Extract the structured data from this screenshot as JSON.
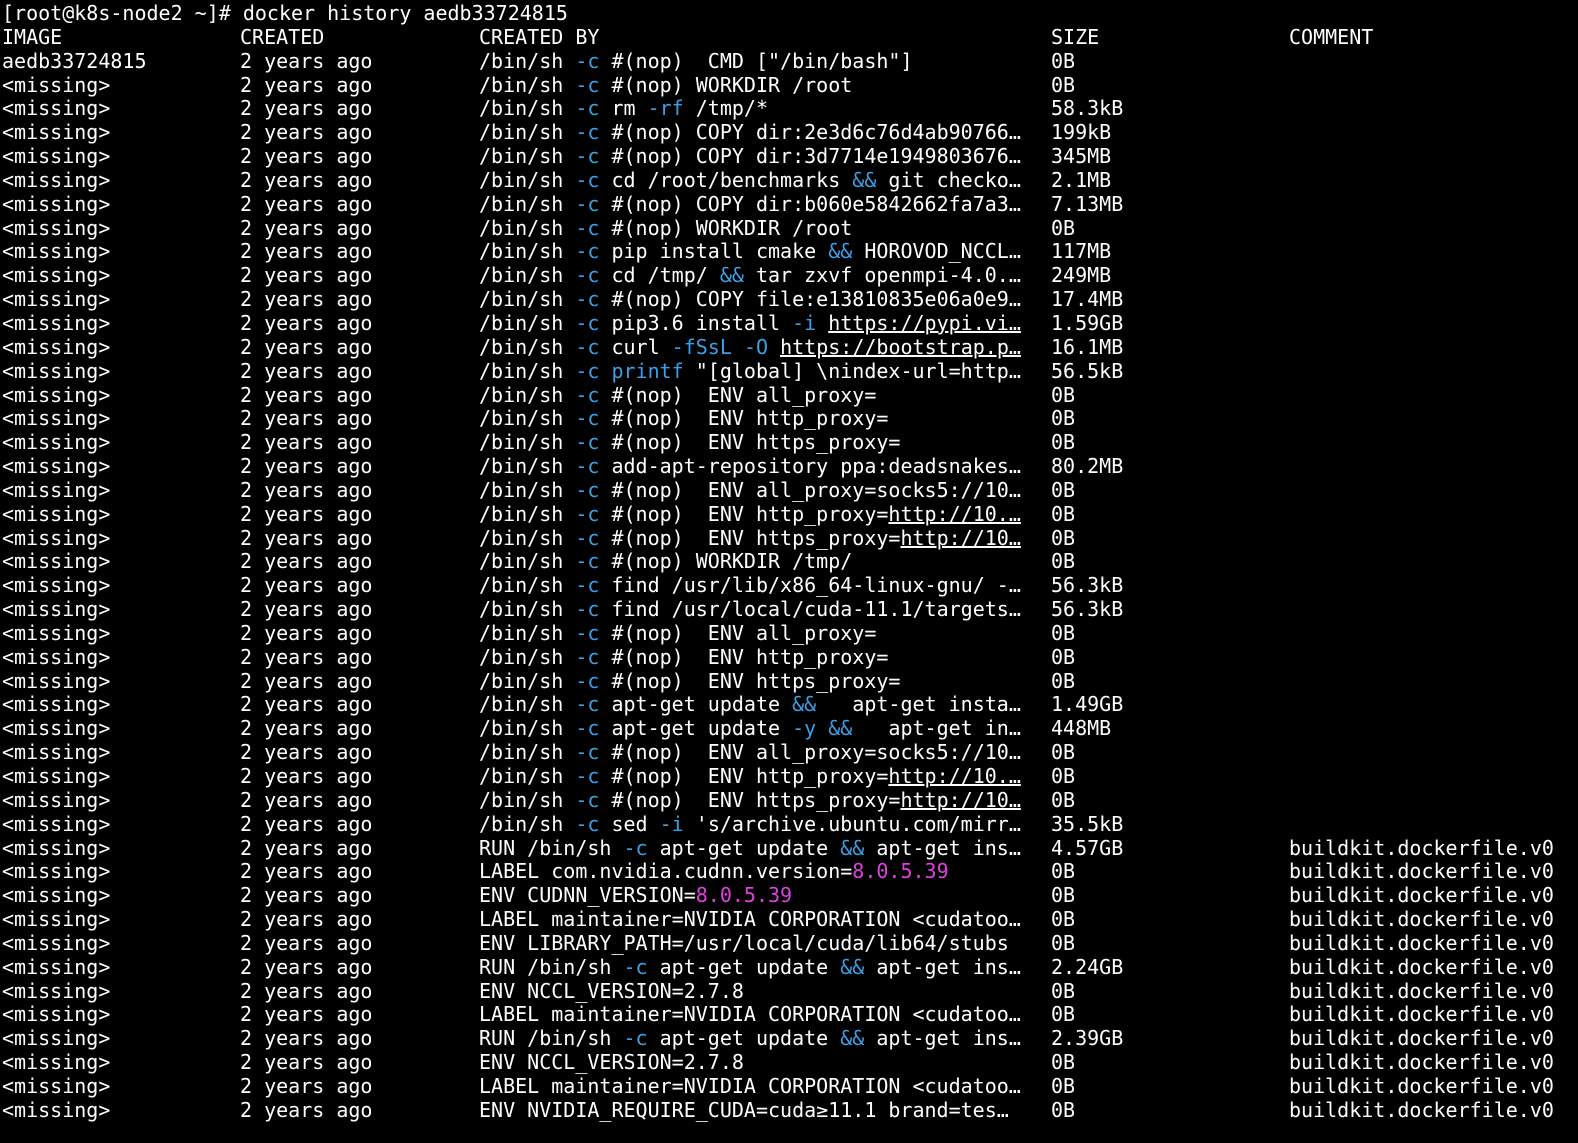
{
  "prompt": "[root@k8s-node2 ~]# docker history aedb33724815",
  "headers": {
    "image": "IMAGE",
    "created": "CREATED",
    "created_by": "CREATED BY",
    "size": "SIZE",
    "comment": "COMMENT"
  },
  "colors": {
    "background": "#000000",
    "text": "#ffffff",
    "flag_blue": "#3aa0e8",
    "version_magenta": "#e040e0"
  },
  "rows": [
    {
      "image": "aedb33724815",
      "created": "2 years ago",
      "by": [
        [
          "/bin/sh ",
          ""
        ],
        [
          "-c",
          "f"
        ],
        [
          " #(nop)  CMD [\"/bin/bash\"]",
          ""
        ]
      ],
      "size": "0B",
      "comment": ""
    },
    {
      "image": "<missing>",
      "created": "2 years ago",
      "by": [
        [
          "/bin/sh ",
          ""
        ],
        [
          "-c",
          "f"
        ],
        [
          " #(nop) WORKDIR /root",
          ""
        ]
      ],
      "size": "0B",
      "comment": ""
    },
    {
      "image": "<missing>",
      "created": "2 years ago",
      "by": [
        [
          "/bin/sh ",
          ""
        ],
        [
          "-c",
          "f"
        ],
        [
          " rm ",
          ""
        ],
        [
          "-rf",
          "f"
        ],
        [
          " /tmp/*",
          ""
        ]
      ],
      "size": "58.3kB",
      "comment": ""
    },
    {
      "image": "<missing>",
      "created": "2 years ago",
      "by": [
        [
          "/bin/sh ",
          ""
        ],
        [
          "-c",
          "f"
        ],
        [
          " #(nop) COPY dir:2e3d6c76d4ab90766…",
          ""
        ]
      ],
      "size": "199kB",
      "comment": ""
    },
    {
      "image": "<missing>",
      "created": "2 years ago",
      "by": [
        [
          "/bin/sh ",
          ""
        ],
        [
          "-c",
          "f"
        ],
        [
          " #(nop) COPY dir:3d7714e1949803676…",
          ""
        ]
      ],
      "size": "345MB",
      "comment": ""
    },
    {
      "image": "<missing>",
      "created": "2 years ago",
      "by": [
        [
          "/bin/sh ",
          ""
        ],
        [
          "-c",
          "f"
        ],
        [
          " cd /root/benchmarks ",
          ""
        ],
        [
          "&&",
          "f"
        ],
        [
          " git checko…",
          ""
        ]
      ],
      "size": "2.1MB",
      "comment": ""
    },
    {
      "image": "<missing>",
      "created": "2 years ago",
      "by": [
        [
          "/bin/sh ",
          ""
        ],
        [
          "-c",
          "f"
        ],
        [
          " #(nop) COPY dir:b060e5842662fa7a3…",
          ""
        ]
      ],
      "size": "7.13MB",
      "comment": ""
    },
    {
      "image": "<missing>",
      "created": "2 years ago",
      "by": [
        [
          "/bin/sh ",
          ""
        ],
        [
          "-c",
          "f"
        ],
        [
          " #(nop) WORKDIR /root",
          ""
        ]
      ],
      "size": "0B",
      "comment": ""
    },
    {
      "image": "<missing>",
      "created": "2 years ago",
      "by": [
        [
          "/bin/sh ",
          ""
        ],
        [
          "-c",
          "f"
        ],
        [
          " pip install cmake ",
          ""
        ],
        [
          "&&",
          "f"
        ],
        [
          " HOROVOD_NCCL…",
          ""
        ]
      ],
      "size": "117MB",
      "comment": ""
    },
    {
      "image": "<missing>",
      "created": "2 years ago",
      "by": [
        [
          "/bin/sh ",
          ""
        ],
        [
          "-c",
          "f"
        ],
        [
          " cd /tmp/ ",
          ""
        ],
        [
          "&&",
          "f"
        ],
        [
          " tar zxvf openmpi-4.0.…",
          ""
        ]
      ],
      "size": "249MB",
      "comment": ""
    },
    {
      "image": "<missing>",
      "created": "2 years ago",
      "by": [
        [
          "/bin/sh ",
          ""
        ],
        [
          "-c",
          "f"
        ],
        [
          " #(nop) COPY file:e13810835e06a0e9…",
          ""
        ]
      ],
      "size": "17.4MB",
      "comment": ""
    },
    {
      "image": "<missing>",
      "created": "2 years ago",
      "by": [
        [
          "/bin/sh ",
          ""
        ],
        [
          "-c",
          "f"
        ],
        [
          " pip3.6 install ",
          ""
        ],
        [
          "-i",
          "f"
        ],
        [
          " ",
          ""
        ],
        [
          "https://pypi.vi…",
          "u"
        ]
      ],
      "size": "1.59GB",
      "comment": ""
    },
    {
      "image": "<missing>",
      "created": "2 years ago",
      "by": [
        [
          "/bin/sh ",
          ""
        ],
        [
          "-c",
          "f"
        ],
        [
          " curl ",
          ""
        ],
        [
          "-fSsL",
          "f"
        ],
        [
          " ",
          ""
        ],
        [
          "-O",
          "f"
        ],
        [
          " ",
          ""
        ],
        [
          "https://bootstrap.p…",
          "u"
        ]
      ],
      "size": "16.1MB",
      "comment": ""
    },
    {
      "image": "<missing>",
      "created": "2 years ago",
      "by": [
        [
          "/bin/sh ",
          ""
        ],
        [
          "-c",
          "f"
        ],
        [
          " ",
          ""
        ],
        [
          "printf",
          "f"
        ],
        [
          " \"[global] \\nindex-url=http…",
          ""
        ]
      ],
      "size": "56.5kB",
      "comment": ""
    },
    {
      "image": "<missing>",
      "created": "2 years ago",
      "by": [
        [
          "/bin/sh ",
          ""
        ],
        [
          "-c",
          "f"
        ],
        [
          " #(nop)  ENV all_proxy=",
          ""
        ]
      ],
      "size": "0B",
      "comment": ""
    },
    {
      "image": "<missing>",
      "created": "2 years ago",
      "by": [
        [
          "/bin/sh ",
          ""
        ],
        [
          "-c",
          "f"
        ],
        [
          " #(nop)  ENV http_proxy=",
          ""
        ]
      ],
      "size": "0B",
      "comment": ""
    },
    {
      "image": "<missing>",
      "created": "2 years ago",
      "by": [
        [
          "/bin/sh ",
          ""
        ],
        [
          "-c",
          "f"
        ],
        [
          " #(nop)  ENV https_proxy=",
          ""
        ]
      ],
      "size": "0B",
      "comment": ""
    },
    {
      "image": "<missing>",
      "created": "2 years ago",
      "by": [
        [
          "/bin/sh ",
          ""
        ],
        [
          "-c",
          "f"
        ],
        [
          " add-apt-repository ppa:deadsnakes…",
          ""
        ]
      ],
      "size": "80.2MB",
      "comment": ""
    },
    {
      "image": "<missing>",
      "created": "2 years ago",
      "by": [
        [
          "/bin/sh ",
          ""
        ],
        [
          "-c",
          "f"
        ],
        [
          " #(nop)  ENV all_proxy=socks5://10…",
          ""
        ]
      ],
      "size": "0B",
      "comment": ""
    },
    {
      "image": "<missing>",
      "created": "2 years ago",
      "by": [
        [
          "/bin/sh ",
          ""
        ],
        [
          "-c",
          "f"
        ],
        [
          " #(nop)  ENV http_proxy=",
          ""
        ],
        [
          "http://10.…",
          "u"
        ]
      ],
      "size": "0B",
      "comment": ""
    },
    {
      "image": "<missing>",
      "created": "2 years ago",
      "by": [
        [
          "/bin/sh ",
          ""
        ],
        [
          "-c",
          "f"
        ],
        [
          " #(nop)  ENV https_proxy=",
          ""
        ],
        [
          "http://10…",
          "u"
        ]
      ],
      "size": "0B",
      "comment": ""
    },
    {
      "image": "<missing>",
      "created": "2 years ago",
      "by": [
        [
          "/bin/sh ",
          ""
        ],
        [
          "-c",
          "f"
        ],
        [
          " #(nop) WORKDIR /tmp/",
          ""
        ]
      ],
      "size": "0B",
      "comment": ""
    },
    {
      "image": "<missing>",
      "created": "2 years ago",
      "by": [
        [
          "/bin/sh ",
          ""
        ],
        [
          "-c",
          "f"
        ],
        [
          " find /usr/lib/x86_64-linux-gnu/ -…",
          ""
        ]
      ],
      "size": "56.3kB",
      "comment": ""
    },
    {
      "image": "<missing>",
      "created": "2 years ago",
      "by": [
        [
          "/bin/sh ",
          ""
        ],
        [
          "-c",
          "f"
        ],
        [
          " find /usr/local/cuda-11.1/targets…",
          ""
        ]
      ],
      "size": "56.3kB",
      "comment": ""
    },
    {
      "image": "<missing>",
      "created": "2 years ago",
      "by": [
        [
          "/bin/sh ",
          ""
        ],
        [
          "-c",
          "f"
        ],
        [
          " #(nop)  ENV all_proxy=",
          ""
        ]
      ],
      "size": "0B",
      "comment": ""
    },
    {
      "image": "<missing>",
      "created": "2 years ago",
      "by": [
        [
          "/bin/sh ",
          ""
        ],
        [
          "-c",
          "f"
        ],
        [
          " #(nop)  ENV http_proxy=",
          ""
        ]
      ],
      "size": "0B",
      "comment": ""
    },
    {
      "image": "<missing>",
      "created": "2 years ago",
      "by": [
        [
          "/bin/sh ",
          ""
        ],
        [
          "-c",
          "f"
        ],
        [
          " #(nop)  ENV https_proxy=",
          ""
        ]
      ],
      "size": "0B",
      "comment": ""
    },
    {
      "image": "<missing>",
      "created": "2 years ago",
      "by": [
        [
          "/bin/sh ",
          ""
        ],
        [
          "-c",
          "f"
        ],
        [
          " apt-get update ",
          ""
        ],
        [
          "&&",
          "f"
        ],
        [
          "   apt-get insta…",
          ""
        ]
      ],
      "size": "1.49GB",
      "comment": ""
    },
    {
      "image": "<missing>",
      "created": "2 years ago",
      "by": [
        [
          "/bin/sh ",
          ""
        ],
        [
          "-c",
          "f"
        ],
        [
          " apt-get update ",
          ""
        ],
        [
          "-y",
          "f"
        ],
        [
          " ",
          ""
        ],
        [
          "&&",
          "f"
        ],
        [
          "   apt-get in…",
          ""
        ]
      ],
      "size": "448MB",
      "comment": ""
    },
    {
      "image": "<missing>",
      "created": "2 years ago",
      "by": [
        [
          "/bin/sh ",
          ""
        ],
        [
          "-c",
          "f"
        ],
        [
          " #(nop)  ENV all_proxy=socks5://10…",
          ""
        ]
      ],
      "size": "0B",
      "comment": ""
    },
    {
      "image": "<missing>",
      "created": "2 years ago",
      "by": [
        [
          "/bin/sh ",
          ""
        ],
        [
          "-c",
          "f"
        ],
        [
          " #(nop)  ENV http_proxy=",
          ""
        ],
        [
          "http://10.…",
          "u"
        ]
      ],
      "size": "0B",
      "comment": ""
    },
    {
      "image": "<missing>",
      "created": "2 years ago",
      "by": [
        [
          "/bin/sh ",
          ""
        ],
        [
          "-c",
          "f"
        ],
        [
          " #(nop)  ENV https_proxy=",
          ""
        ],
        [
          "http://10…",
          "u"
        ]
      ],
      "size": "0B",
      "comment": ""
    },
    {
      "image": "<missing>",
      "created": "2 years ago",
      "by": [
        [
          "/bin/sh ",
          ""
        ],
        [
          "-c",
          "f"
        ],
        [
          " sed ",
          ""
        ],
        [
          "-i",
          "f"
        ],
        [
          " 's/archive.ubuntu.com/mirr…",
          ""
        ]
      ],
      "size": "35.5kB",
      "comment": ""
    },
    {
      "image": "<missing>",
      "created": "2 years ago",
      "by": [
        [
          "RUN /bin/sh ",
          ""
        ],
        [
          "-c",
          "f"
        ],
        [
          " apt-get update ",
          ""
        ],
        [
          "&&",
          "f"
        ],
        [
          " apt-get ins…",
          ""
        ]
      ],
      "size": "4.57GB",
      "comment": "buildkit.dockerfile.v0"
    },
    {
      "image": "<missing>",
      "created": "2 years ago",
      "by": [
        [
          "LABEL com.nvidia.cudnn.version=",
          ""
        ],
        [
          "8.0.5.39",
          "m"
        ]
      ],
      "size": "0B",
      "comment": "buildkit.dockerfile.v0"
    },
    {
      "image": "<missing>",
      "created": "2 years ago",
      "by": [
        [
          "ENV CUDNN_VERSION=",
          ""
        ],
        [
          "8.0.5.39",
          "m"
        ]
      ],
      "size": "0B",
      "comment": "buildkit.dockerfile.v0"
    },
    {
      "image": "<missing>",
      "created": "2 years ago",
      "by": [
        [
          "LABEL maintainer=NVIDIA CORPORATION <cudatoo…",
          ""
        ]
      ],
      "size": "0B",
      "comment": "buildkit.dockerfile.v0"
    },
    {
      "image": "<missing>",
      "created": "2 years ago",
      "by": [
        [
          "ENV LIBRARY_PATH=/usr/local/cuda/lib64/stubs",
          ""
        ]
      ],
      "size": "0B",
      "comment": "buildkit.dockerfile.v0"
    },
    {
      "image": "<missing>",
      "created": "2 years ago",
      "by": [
        [
          "RUN /bin/sh ",
          ""
        ],
        [
          "-c",
          "f"
        ],
        [
          " apt-get update ",
          ""
        ],
        [
          "&&",
          "f"
        ],
        [
          " apt-get ins…",
          ""
        ]
      ],
      "size": "2.24GB",
      "comment": "buildkit.dockerfile.v0"
    },
    {
      "image": "<missing>",
      "created": "2 years ago",
      "by": [
        [
          "ENV NCCL_VERSION=2.7.8",
          ""
        ]
      ],
      "size": "0B",
      "comment": "buildkit.dockerfile.v0"
    },
    {
      "image": "<missing>",
      "created": "2 years ago",
      "by": [
        [
          "LABEL maintainer=NVIDIA CORPORATION <cudatoo…",
          ""
        ]
      ],
      "size": "0B",
      "comment": "buildkit.dockerfile.v0"
    },
    {
      "image": "<missing>",
      "created": "2 years ago",
      "by": [
        [
          "RUN /bin/sh ",
          ""
        ],
        [
          "-c",
          "f"
        ],
        [
          " apt-get update ",
          ""
        ],
        [
          "&&",
          "f"
        ],
        [
          " apt-get ins…",
          ""
        ]
      ],
      "size": "2.39GB",
      "comment": "buildkit.dockerfile.v0"
    },
    {
      "image": "<missing>",
      "created": "2 years ago",
      "by": [
        [
          "ENV NCCL_VERSION=2.7.8",
          ""
        ]
      ],
      "size": "0B",
      "comment": "buildkit.dockerfile.v0"
    },
    {
      "image": "<missing>",
      "created": "2 years ago",
      "by": [
        [
          "LABEL maintainer=NVIDIA CORPORATION <cudatoo…",
          ""
        ]
      ],
      "size": "0B",
      "comment": "buildkit.dockerfile.v0"
    },
    {
      "image": "<missing>",
      "created": "2 years ago",
      "by": [
        [
          "ENV NVIDIA_REQUIRE_CUDA=cuda≥11.1 brand=tes…",
          ""
        ]
      ],
      "size": "0B",
      "comment": "buildkit.dockerfile.v0"
    }
  ]
}
